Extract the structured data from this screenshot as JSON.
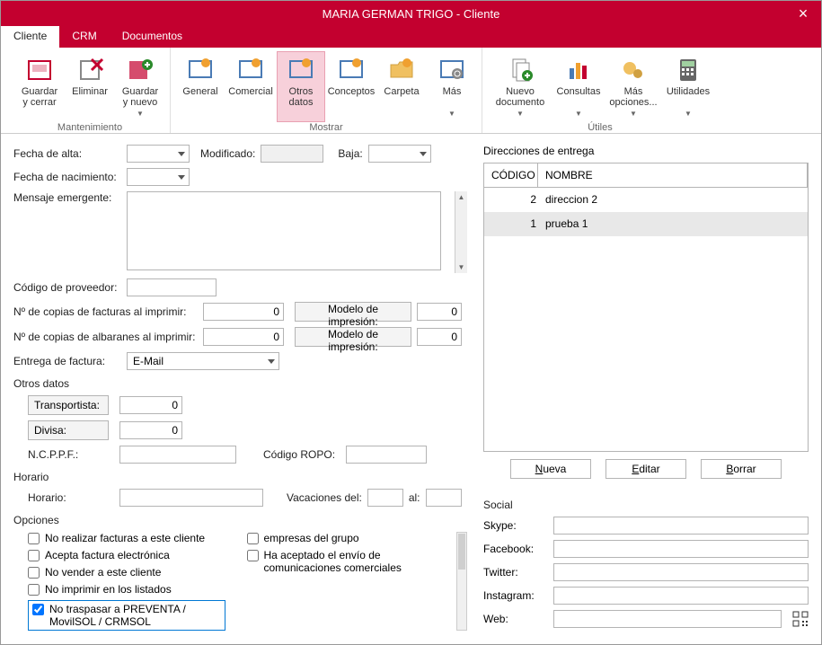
{
  "window": {
    "title": "MARIA GERMAN TRIGO  - Cliente"
  },
  "tabs": {
    "cliente": "Cliente",
    "crm": "CRM",
    "documentos": "Documentos"
  },
  "ribbon": {
    "mantenimiento": {
      "label": "Mantenimiento",
      "guardar_cerrar": "Guardar\ny cerrar",
      "eliminar": "Eliminar",
      "guardar_nuevo": "Guardar\ny nuevo"
    },
    "mostrar": {
      "label": "Mostrar",
      "general": "General",
      "comercial": "Comercial",
      "otros_datos": "Otros\ndatos",
      "conceptos": "Conceptos",
      "carpeta": "Carpeta",
      "mas": "Más"
    },
    "utiles": {
      "label": "Útiles",
      "nuevo_doc": "Nuevo\ndocumento",
      "consultas": "Consultas",
      "mas_opciones": "Más\nopciones...",
      "utilidades": "Utilidades"
    }
  },
  "form": {
    "fecha_alta_lbl": "Fecha de alta:",
    "modificado_lbl": "Modificado:",
    "baja_lbl": "Baja:",
    "fecha_nacimiento_lbl": "Fecha de  nacimiento:",
    "mensaje_emergente_lbl": "Mensaje emergente:",
    "codigo_proveedor_lbl": "Código de proveedor:",
    "copias_facturas_lbl": "Nº de copias de facturas al imprimir:",
    "copias_albaranes_lbl": "Nº de copias de albaranes al imprimir:",
    "modelo_impresion_lbl": "Modelo de impresión:",
    "entrega_factura_lbl": "Entrega de factura:",
    "entrega_factura_val": "E-Mail",
    "copias_facturas_val": "0",
    "copias_albaranes_val": "0",
    "modelo1_val": "0",
    "modelo2_val": "0"
  },
  "otros_datos": {
    "header": "Otros datos",
    "transportista_lbl": "Transportista:",
    "divisa_lbl": "Divisa:",
    "ncppf_lbl": "N.C.P.P.F.:",
    "codigo_ropo_lbl": "Código ROPO:",
    "transportista_val": "0",
    "divisa_val": "0"
  },
  "horario": {
    "header": "Horario",
    "horario_lbl": "Horario:",
    "vacaciones_lbl": "Vacaciones del:",
    "al_lbl": "al:"
  },
  "opciones": {
    "header": "Opciones",
    "no_facturas": "No realizar facturas a este cliente",
    "acepta_fe": "Acepta factura electrónica",
    "no_vender": "No vender a este cliente",
    "no_imprimir": "No imprimir en los listados",
    "no_traspasar": "No traspasar a PREVENTA / MovilSOL / CRMSOL",
    "empresas_grupo": "empresas del grupo",
    "ha_aceptado": "Ha aceptado el envío de comunicaciones comerciales"
  },
  "delivery": {
    "header": "Direcciones de entrega",
    "col_codigo": "CÓDIGO",
    "col_nombre": "NOMBRE",
    "rows": [
      {
        "codigo": "2",
        "nombre": "direccion 2"
      },
      {
        "codigo": "1",
        "nombre": "prueba 1"
      }
    ],
    "nueva": "Nueva",
    "editar": "Editar",
    "borrar": "Borrar"
  },
  "social": {
    "header": "Social",
    "skype": "Skype:",
    "facebook": "Facebook:",
    "twitter": "Twitter:",
    "instagram": "Instagram:",
    "web": "Web:"
  }
}
